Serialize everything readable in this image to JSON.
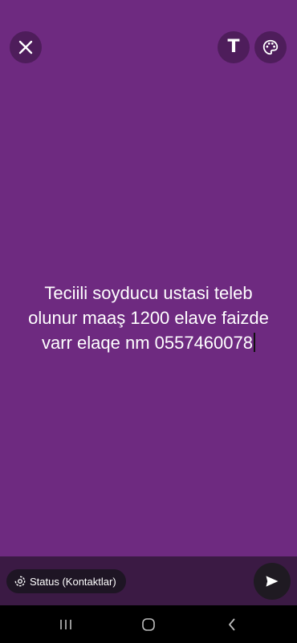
{
  "toolbar": {
    "close_icon": "close-icon",
    "text_tool_label": "T",
    "palette_icon": "palette-icon"
  },
  "status": {
    "line1": "Teciili soyducu ustasi teleb",
    "line2": "olunur maaş 1200 elave faizde",
    "line3": "varr elaqe nm 0557460078",
    "background_color": "#6e2a80"
  },
  "footer": {
    "audience_label": "Status (Kontaktlar)",
    "audience_icon": "status-icon",
    "send_icon": "send-icon"
  },
  "nav": {
    "recent_icon": "recent-apps-icon",
    "home_icon": "home-icon",
    "back_icon": "back-icon"
  }
}
